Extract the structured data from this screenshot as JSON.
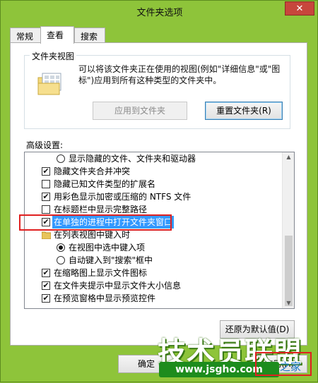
{
  "window": {
    "title": "文件夹选项",
    "close_glyph": "✕"
  },
  "tabs": [
    {
      "label": "常规"
    },
    {
      "label": "查看"
    },
    {
      "label": "搜索"
    }
  ],
  "folder_view": {
    "title": "文件夹视图",
    "description": "可以将该文件夹正在使用的视图(例如\"详细信息\"或\"图标\")应用到所有这种类型的文件夹中。",
    "apply_button": "应用到文件夹",
    "reset_button": "重置文件夹(R)"
  },
  "advanced": {
    "label": "高级设置:",
    "items": [
      {
        "kind": "radio",
        "on": false,
        "indent": 2,
        "text": "显示隐藏的文件、文件夹和驱动器"
      },
      {
        "kind": "check",
        "on": true,
        "indent": 1,
        "text": "隐藏文件夹合并冲突"
      },
      {
        "kind": "check",
        "on": false,
        "indent": 1,
        "text": "隐藏已知文件类型的扩展名"
      },
      {
        "kind": "check",
        "on": true,
        "indent": 1,
        "text": "用彩色显示加密或压缩的 NTFS 文件"
      },
      {
        "kind": "check",
        "on": false,
        "indent": 1,
        "text": "在标题栏中显示完整路径"
      },
      {
        "kind": "check",
        "on": true,
        "indent": 1,
        "text": "在单独的进程中打开文件夹窗口",
        "selected": true
      },
      {
        "kind": "folder",
        "on": false,
        "indent": 1,
        "text": "在列表视图中键入时"
      },
      {
        "kind": "radio",
        "on": true,
        "indent": 2,
        "text": "在视图中选中键入项"
      },
      {
        "kind": "radio",
        "on": false,
        "indent": 2,
        "text": "自动键入到\"搜索\"框中"
      },
      {
        "kind": "check",
        "on": true,
        "indent": 1,
        "text": "在缩略图上显示文件图标"
      },
      {
        "kind": "check",
        "on": true,
        "indent": 1,
        "text": "在文件夹提示中显示文件大小信息"
      },
      {
        "kind": "check",
        "on": true,
        "indent": 1,
        "text": "在预览窗格中显示预览控件"
      }
    ],
    "restore_defaults": "还原为默认值(D)"
  },
  "footer": {
    "ok_button": "确定",
    "apply_button": "应用(A)"
  },
  "watermark": {
    "logo_text": "技术员联盟",
    "url": "www.jsgho.com",
    "tail": "之家"
  }
}
